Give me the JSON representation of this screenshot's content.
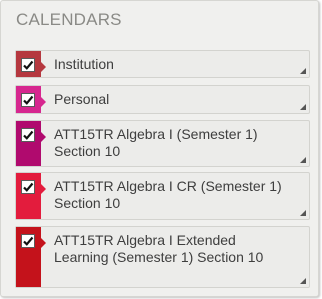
{
  "panel": {
    "title": "CALENDARS"
  },
  "calendars": [
    {
      "label": "Institution",
      "color": "#b5383f",
      "checked": true
    },
    {
      "label": "Personal",
      "color": "#d6278f",
      "checked": true
    },
    {
      "label": "ATT15TR Algebra I (Semester 1) Section 10",
      "color": "#b00a6e",
      "checked": true
    },
    {
      "label": "ATT15TR Algebra I CR (Semester 1) Section 10",
      "color": "#e31c3d",
      "checked": true
    },
    {
      "label": "ATT15TR Algebra I Extended Learning (Semester 1) Section 10",
      "color": "#c4121b",
      "checked": true
    }
  ],
  "icons": {
    "check": "checkmark-icon",
    "grip": "resize-grip-icon",
    "pointer": "arrow-right-icon"
  }
}
